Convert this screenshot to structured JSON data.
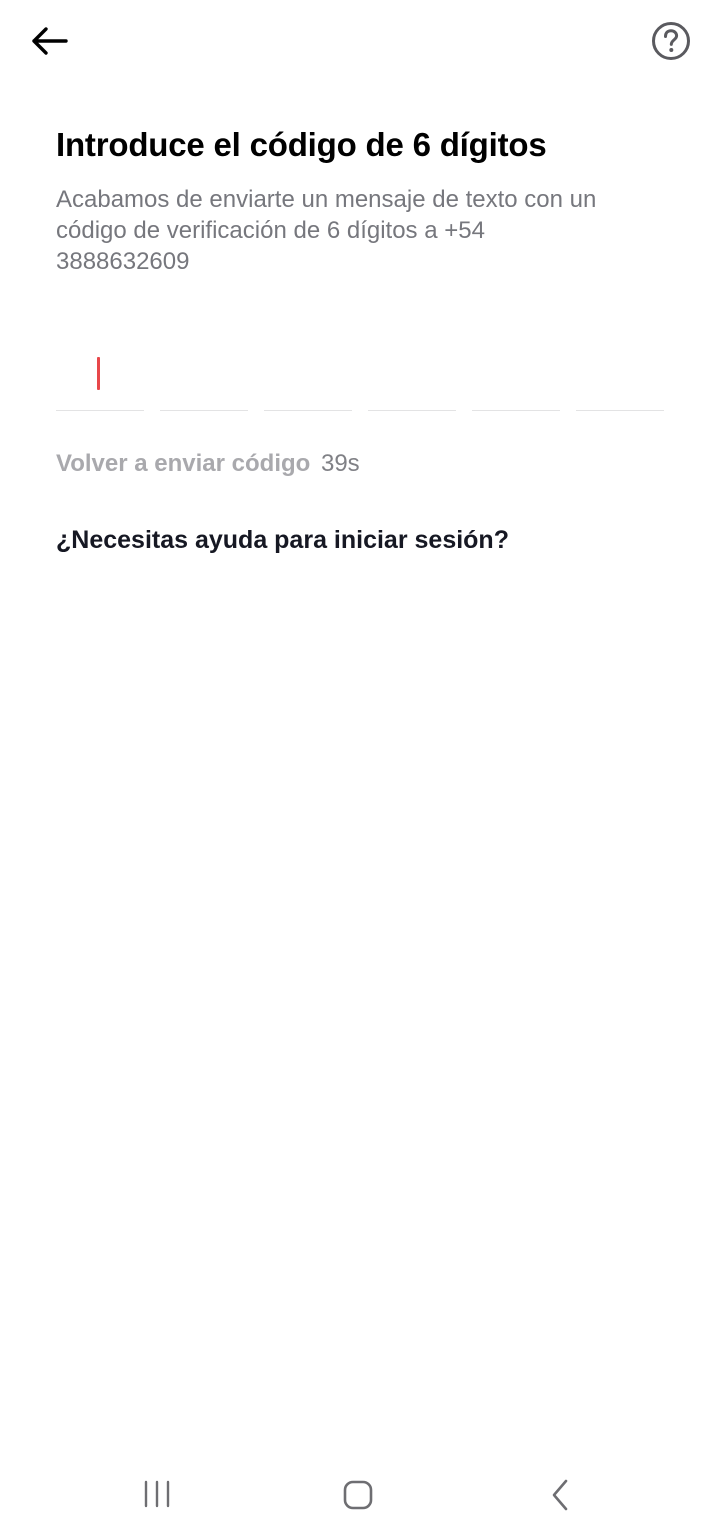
{
  "header": {
    "back_icon": "arrow-left-icon",
    "help_icon": "question-circle-icon"
  },
  "main": {
    "title": "Introduce el código de 6 dígitos",
    "subtitle": "Acabamos de enviarte un mensaje de texto con un código de verificación de 6 dígitos a +54 3888632609",
    "code_digits": [
      "",
      "",
      "",
      "",
      "",
      ""
    ],
    "resend_label": "Volver a enviar código",
    "resend_timer": "39s",
    "help_link": "¿Necesitas ayuda para iniciar sesión?"
  },
  "colors": {
    "caret": "#e8474a",
    "title": "#000000",
    "subtitle": "#76777d",
    "resend_disabled": "#a9a9ad"
  },
  "system_nav": {
    "recents_icon": "recents-icon",
    "home_icon": "home-icon",
    "back_icon": "chevron-left-icon"
  }
}
